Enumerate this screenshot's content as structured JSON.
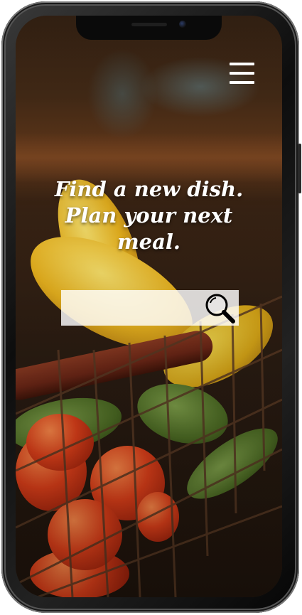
{
  "header": {
    "menu_icon": "hamburger-menu-icon"
  },
  "hero": {
    "headline_lines": [
      "Find a new dish.",
      "Plan your next",
      "meal."
    ]
  },
  "search": {
    "value": "",
    "placeholder": "",
    "icon": "search-icon"
  },
  "colors": {
    "text": "#ffffff",
    "search_background": "#ffffffd1",
    "search_icon": "#000000"
  }
}
